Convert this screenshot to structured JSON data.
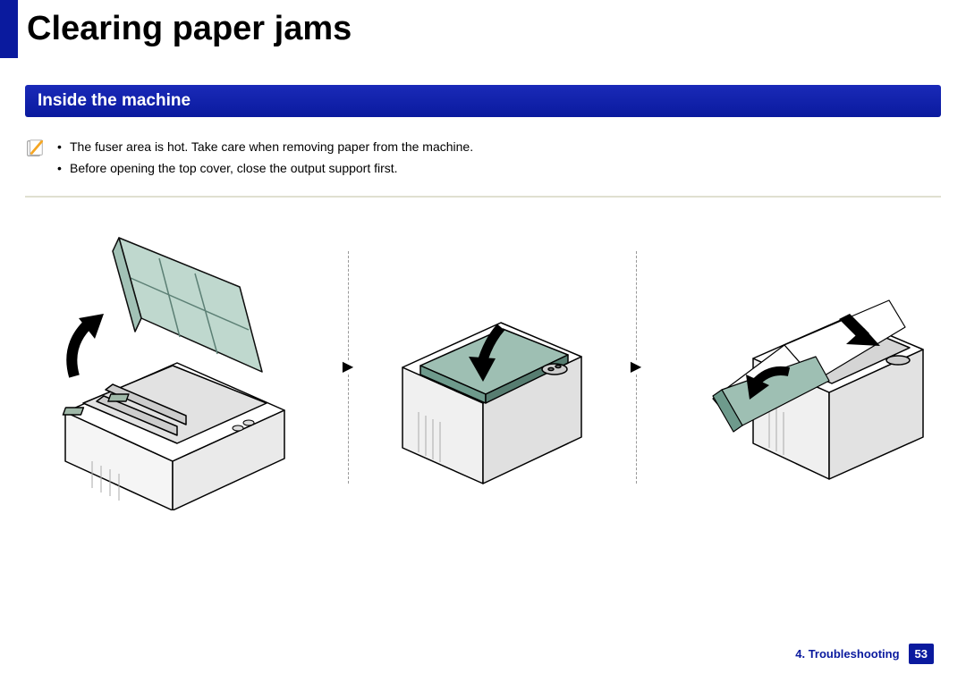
{
  "header": {
    "title": "Clearing paper jams"
  },
  "section": {
    "title": "Inside the machine"
  },
  "notes": {
    "items": {
      "0": "The fuser area is hot. Take care when removing paper from the machine.",
      "1": "Before opening the top cover, close the output support first."
    }
  },
  "footer": {
    "chapter": "4. Troubleshooting",
    "page": "53"
  }
}
